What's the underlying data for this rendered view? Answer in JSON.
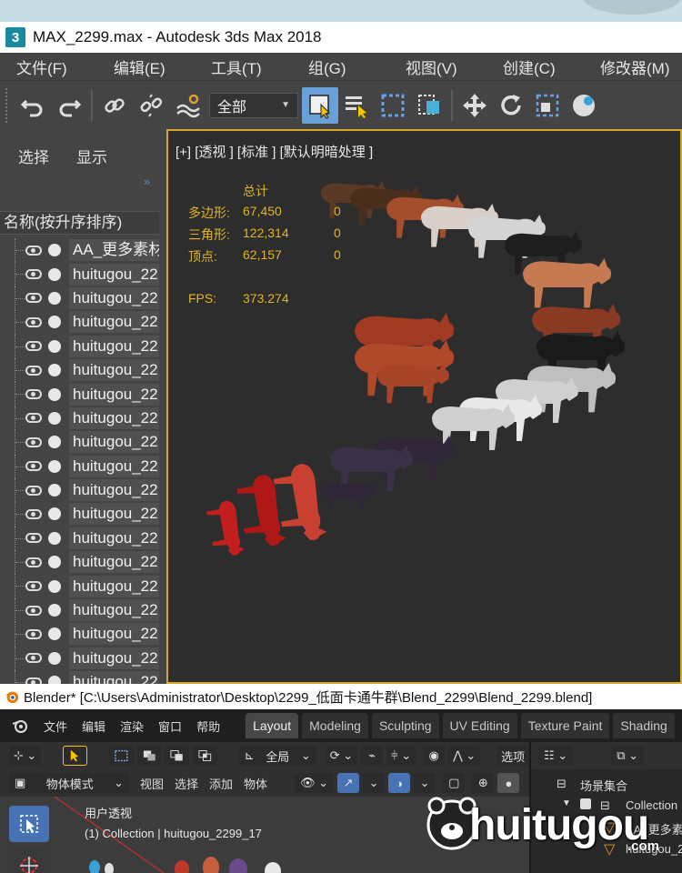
{
  "max": {
    "title": "MAX_2299.max - Autodesk 3ds Max 2018",
    "logo_letter": "3",
    "menu": [
      "文件(F)",
      "编辑(E)",
      "工具(T)",
      "组(G)",
      "视图(V)",
      "创建(C)",
      "修改器(M)"
    ],
    "toolbar": {
      "filter_value": "全部"
    },
    "panel": {
      "tabs": [
        "选择",
        "显示"
      ],
      "header": "名称(按升序排序)",
      "items": [
        "AA_更多素材",
        "huitugou_22",
        "huitugou_22",
        "huitugou_22",
        "huitugou_22",
        "huitugou_22",
        "huitugou_22",
        "huitugou_22",
        "huitugou_22",
        "huitugou_22",
        "huitugou_22",
        "huitugou_22",
        "huitugou_22",
        "huitugou_22",
        "huitugou_22",
        "huitugou_22",
        "huitugou_22",
        "huitugou_22",
        "huitugou_22"
      ]
    },
    "viewport": {
      "label": "[+] [透视 ] [标准 ] [默认明暗处理 ]",
      "stats": {
        "total_label": "总计",
        "rows": [
          {
            "label": "多边形:",
            "value": "67,450",
            "sel": "0"
          },
          {
            "label": "三角形:",
            "value": "122,314",
            "sel": "0"
          },
          {
            "label": "顶点:",
            "value": "62,157",
            "sel": "0"
          }
        ],
        "fps_label": "FPS:",
        "fps_value": "373.274"
      }
    }
  },
  "blender": {
    "title": "Blender* [C:\\Users\\Administrator\\Desktop\\2299_低面卡通牛群\\Blend_2299\\Blend_2299.blend]",
    "menu": [
      "文件",
      "编辑",
      "渲染",
      "窗口",
      "帮助"
    ],
    "workspaces": [
      "Layout",
      "Modeling",
      "Sculpting",
      "UV Editing",
      "Texture Paint",
      "Shading"
    ],
    "header1": {
      "orientation": "全局",
      "options": "选项"
    },
    "header2": {
      "mode": "物体模式",
      "view": "视图",
      "select": "选择",
      "add": "添加",
      "object": "物体"
    },
    "viewport": {
      "perspective": "用户透视",
      "collection_info": "(1) Collection | huitugou_2299_17"
    },
    "outliner": {
      "scene_collection": "场景集合",
      "items": [
        "Collection",
        "AA_更多素",
        "huitugou_2"
      ]
    }
  },
  "watermark": {
    "brand": "huitugou",
    "suffix": ".com"
  }
}
